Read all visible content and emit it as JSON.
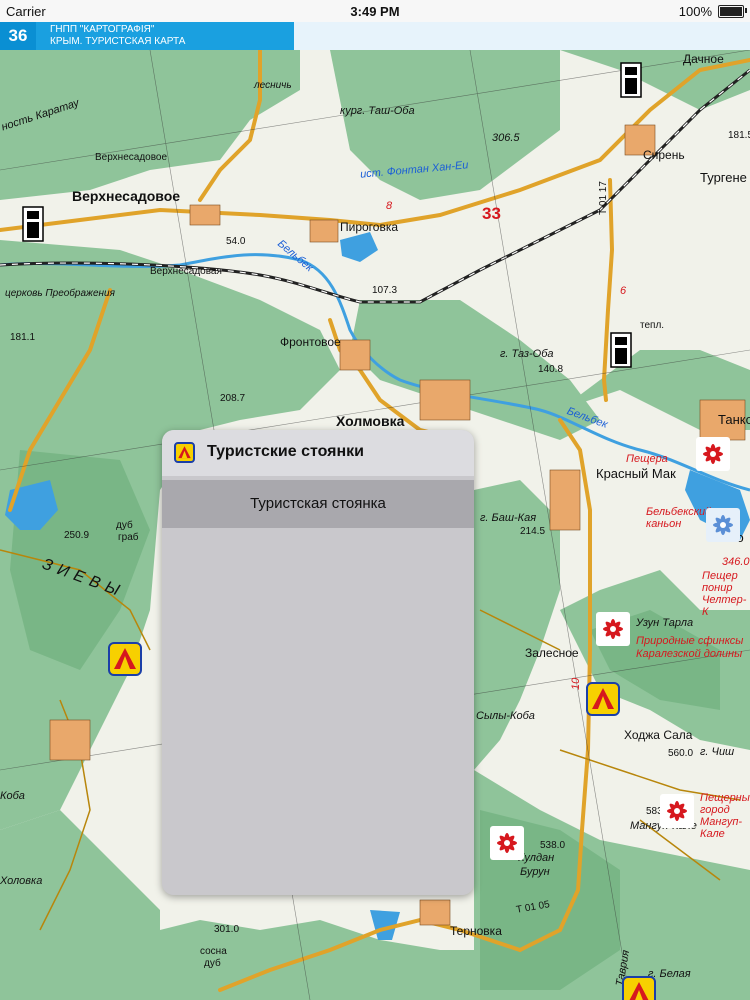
{
  "status_bar": {
    "carrier": "Carrier",
    "time": "3:49 PM",
    "battery": "100%"
  },
  "header": {
    "page_number": "36",
    "title_line1": "ГНПП \"КАРТОГРАФІЯ\"",
    "title_line2": "КРЫМ. ТУРИСТСКАЯ КАРТА"
  },
  "map": {
    "labels": {
      "dachnoe": "Дачное",
      "kurg_tash_oba": "кург. Таш-Оба",
      "verkhnesadovoe_small": "Верхнесадовое",
      "verkhnesadovoe": "Верхнесадовое",
      "verkhnesadovaya": "Верхнесадовая",
      "pirogovka": "Пироговка",
      "sersen": "Сирень",
      "turgene": "Тургене",
      "h306": "306.5",
      "h181_right": "181.5",
      "road33": "33",
      "ist_fontan": "ист. Фонтан Хан-Еи",
      "t0117": "Т 01 17",
      "h54": "54.0",
      "belbek1": "Бельбек",
      "h107": "107.3",
      "tserkov": "церковь Преображения",
      "h181": "181.1",
      "frontovoe": "Фронтовое",
      "taz_oba": "г. Таз-Оба",
      "h140": "140.8",
      "tepl": "тепл.",
      "h208": "208.7",
      "kholmovka": "Холмовка",
      "tankovoe": "Танко",
      "belbek2": "Бельбек",
      "peshchera1": "Пещера",
      "krasny_mak": "Красный Мак",
      "belbek_kan": "Бельбекский каньон",
      "bo": "Бо",
      "dub": "дуб",
      "grab": "граб",
      "h250": "250.9",
      "bash_kaya": "г. Баш-Кая",
      "h214": "214.5",
      "h346": "346.0",
      "peshchery2": "Пещер понир Челтер-К",
      "uzun_tarla": "Узун Тарла",
      "sfinksy": "Природные сфинксы Каралезской долины",
      "zalesnoe": "Залесное",
      "khodzha_sala": "Ходжа Сала",
      "h560": "560.0",
      "chish": "г. Чиш",
      "kokoba": "Коба",
      "syly_koba": "Сылы-Коба",
      "mangup": "Пещерный город Мангуп-Кале",
      "h583": "583.7",
      "mangup_kale": "Мангуп-Кале",
      "h538": "538.0",
      "buldan": "Бурун",
      "kuldan": "Кулдан",
      "t0105": "Т 01 05",
      "holovka": "Холовка",
      "h301": "301.0",
      "sosna": "сосна",
      "dub2": "дуб",
      "ternovka": "Терновка",
      "belaya": "г. Белая",
      "tavriya": "Таврия",
      "karatau": "ность Каратау",
      "rzievy": "ЗИЕВЫ",
      "r10": "10",
      "r8": "8",
      "r6": "6",
      "lesnich": "лесничь"
    }
  },
  "popup": {
    "title": "Туристские стоянки",
    "items": [
      "Туристская стоянка"
    ]
  },
  "colors": {
    "forest": "#8fc49a",
    "forest_dark": "#6fb07e",
    "open": "#f1f2ea",
    "road": "#e0a32a",
    "water": "#3fa0e0",
    "rail": "#222222",
    "header_blue": "#1aa0e0",
    "camp_yellow": "#f7d000",
    "attraction_red": "#d6181e"
  }
}
